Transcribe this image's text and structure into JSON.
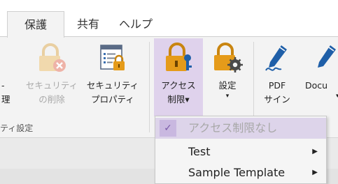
{
  "tabs": [
    "保護",
    "共有",
    "ヘルプ"
  ],
  "group_label": "ティ設定",
  "left_partial": {
    "line1": "-",
    "line2": "理"
  },
  "buttons": {
    "delete_security": {
      "line1": "セキュリティ",
      "line2": "の削除"
    },
    "security_props": {
      "line1": "セキュリティ",
      "line2": "プロパティ"
    },
    "access_restrict": {
      "line1": "アクセス",
      "line2": "制限",
      "caret": "▾"
    },
    "settings": {
      "line1": "設定",
      "caret": "▾"
    },
    "pdf_sign": {
      "line1": "PDF",
      "line2": "サイン"
    },
    "docu": {
      "line1": "Docu",
      "caret": "▾"
    }
  },
  "menu": {
    "items": [
      {
        "label": "アクセス制限なし",
        "checked": true,
        "disabled": true
      },
      {
        "label": "Test",
        "submenu": true
      },
      {
        "label": "Sample Template",
        "submenu": true
      }
    ]
  },
  "colors": {
    "accent_purple": "#7b4fb0",
    "lock_gold": "#e59b1a",
    "pen_blue": "#1f5fa8"
  }
}
